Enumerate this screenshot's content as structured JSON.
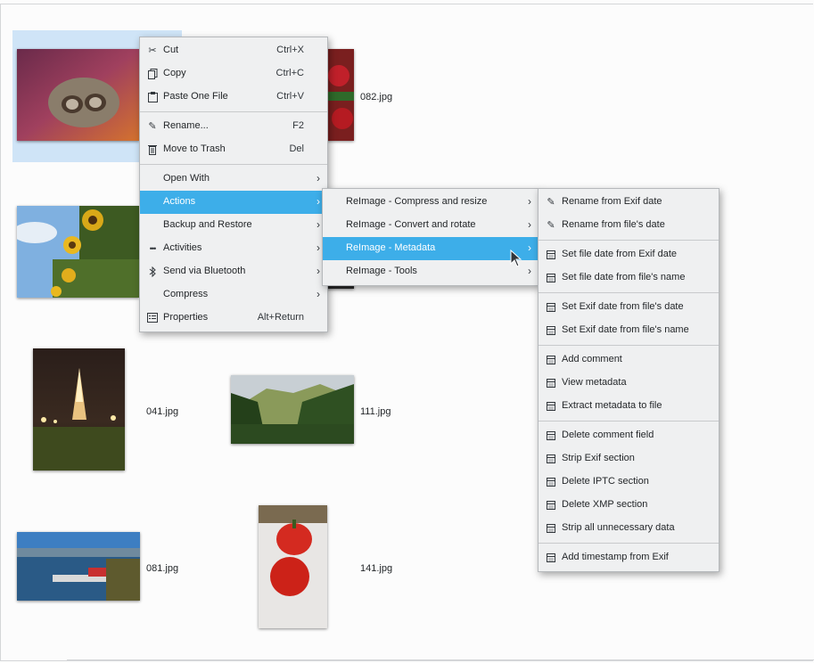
{
  "files": [
    {
      "name": "082.jpg"
    },
    {
      "name": "041.jpg"
    },
    {
      "name": "111.jpg"
    },
    {
      "name": "081.jpg"
    },
    {
      "name": "141.jpg"
    }
  ],
  "context_menu": {
    "items": [
      {
        "label": "Cut",
        "shortcut": "Ctrl+X",
        "icon": "scissors-icon"
      },
      {
        "label": "Copy",
        "shortcut": "Ctrl+C",
        "icon": "copy-icon"
      },
      {
        "label": "Paste One File",
        "shortcut": "Ctrl+V",
        "icon": "paste-icon"
      },
      {
        "label": "Rename...",
        "shortcut": "F2",
        "icon": "pencil-icon"
      },
      {
        "label": "Move to Trash",
        "shortcut": "Del",
        "icon": "trash-icon"
      },
      {
        "label": "Open With"
      },
      {
        "label": "Actions"
      },
      {
        "label": "Backup and Restore"
      },
      {
        "label": "Activities",
        "icon": "activities-icon"
      },
      {
        "label": "Send via Bluetooth",
        "icon": "bluetooth-icon"
      },
      {
        "label": "Compress"
      },
      {
        "label": "Properties",
        "shortcut": "Alt+Return",
        "icon": "properties-icon"
      }
    ]
  },
  "actions_menu": {
    "items": [
      {
        "label": "ReImage - Compress and resize"
      },
      {
        "label": "ReImage - Convert and rotate"
      },
      {
        "label": "ReImage - Metadata"
      },
      {
        "label": "ReImage - Tools"
      }
    ]
  },
  "metadata_menu": {
    "items": [
      {
        "label": "Rename from Exif date",
        "icon": "pencil-icon"
      },
      {
        "label": "Rename from file's date",
        "icon": "pencil-icon"
      },
      {
        "label": "Set file date from Exif date",
        "icon": "calendar-icon"
      },
      {
        "label": "Set file date from file's name",
        "icon": "calendar-icon"
      },
      {
        "label": "Set Exif date from file's date",
        "icon": "calendar-icon"
      },
      {
        "label": "Set Exif date from file's name",
        "icon": "calendar-icon"
      },
      {
        "label": "Add comment",
        "icon": "calendar-icon"
      },
      {
        "label": "View metadata",
        "icon": "calendar-icon"
      },
      {
        "label": "Extract metadata to file",
        "icon": "calendar-icon"
      },
      {
        "label": "Delete comment field",
        "icon": "calendar-icon"
      },
      {
        "label": "Strip Exif section",
        "icon": "calendar-icon"
      },
      {
        "label": "Delete IPTC section",
        "icon": "calendar-icon"
      },
      {
        "label": "Delete XMP section",
        "icon": "calendar-icon"
      },
      {
        "label": "Strip all unnecessary data",
        "icon": "calendar-icon"
      },
      {
        "label": "Add timestamp from Exif",
        "icon": "calendar-icon"
      }
    ]
  },
  "colors": {
    "highlight": "#3daee9",
    "selection": "#cfe4f7",
    "menu_bg": "#eff0f1"
  }
}
